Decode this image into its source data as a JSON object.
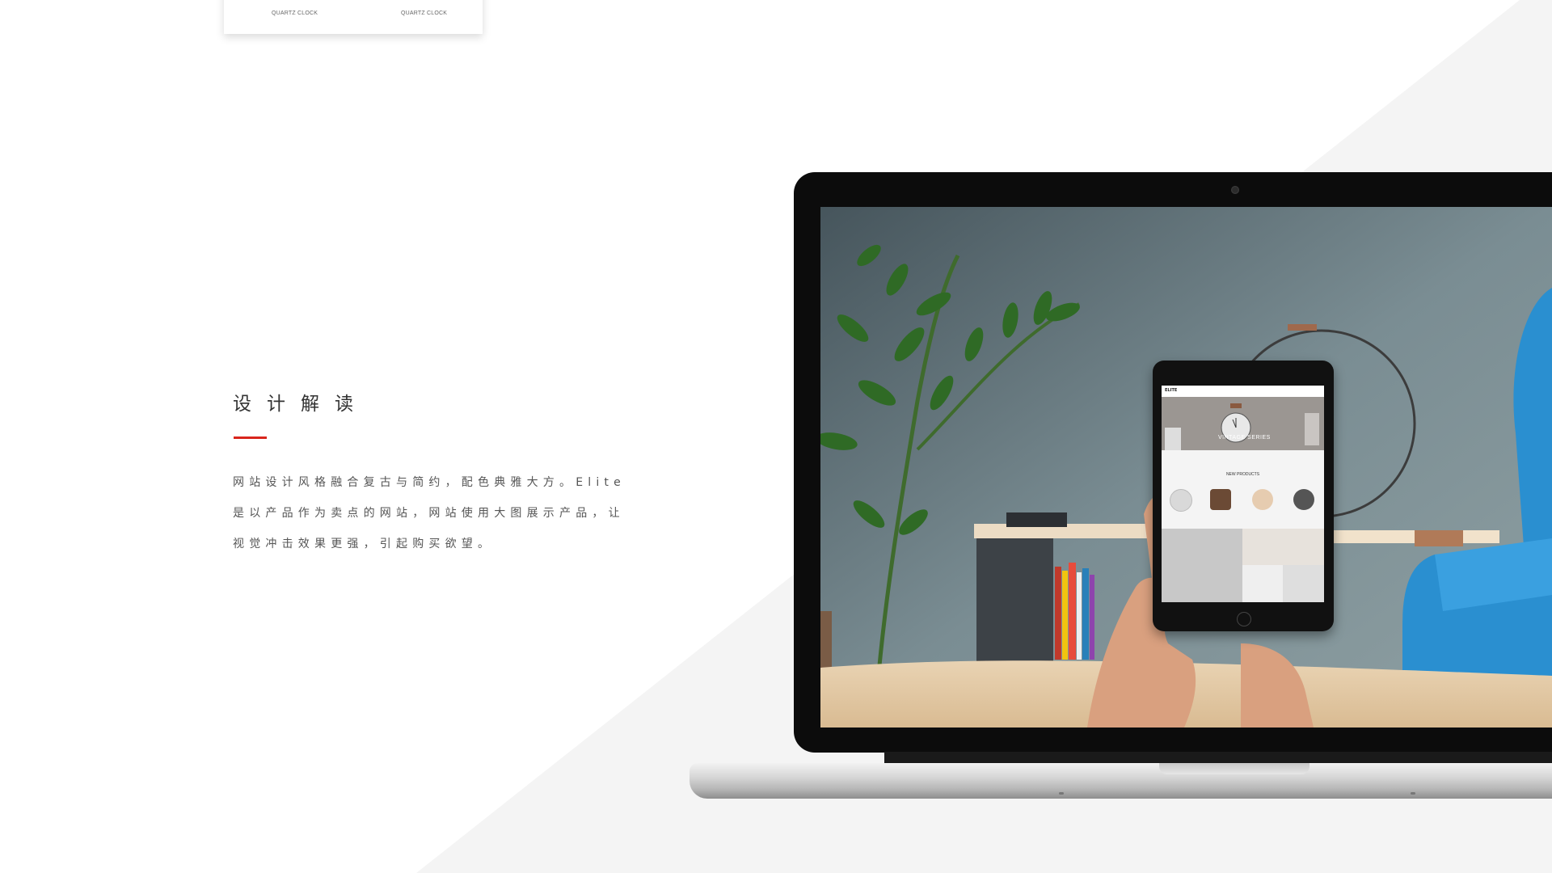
{
  "top_card": {
    "caption_left": "QUARTZ CLOCK",
    "caption_right": "QUARTZ CLOCK"
  },
  "section": {
    "heading": "设计解读",
    "lines": [
      "网站设计风格融合复古与简约，配色典雅大方。Elite",
      "是以产品作为卖点的网站，网站使用大图展示产品，让",
      "视觉冲击效果更强，引起购买欲望。"
    ]
  },
  "tablet_site": {
    "logo": "ELITE",
    "hero_title": "VINTAGE SERIES",
    "section_title": "NEW PRODUCTS"
  },
  "colors": {
    "accent_red": "#d9251c",
    "background_gray": "#f4f4f4"
  }
}
